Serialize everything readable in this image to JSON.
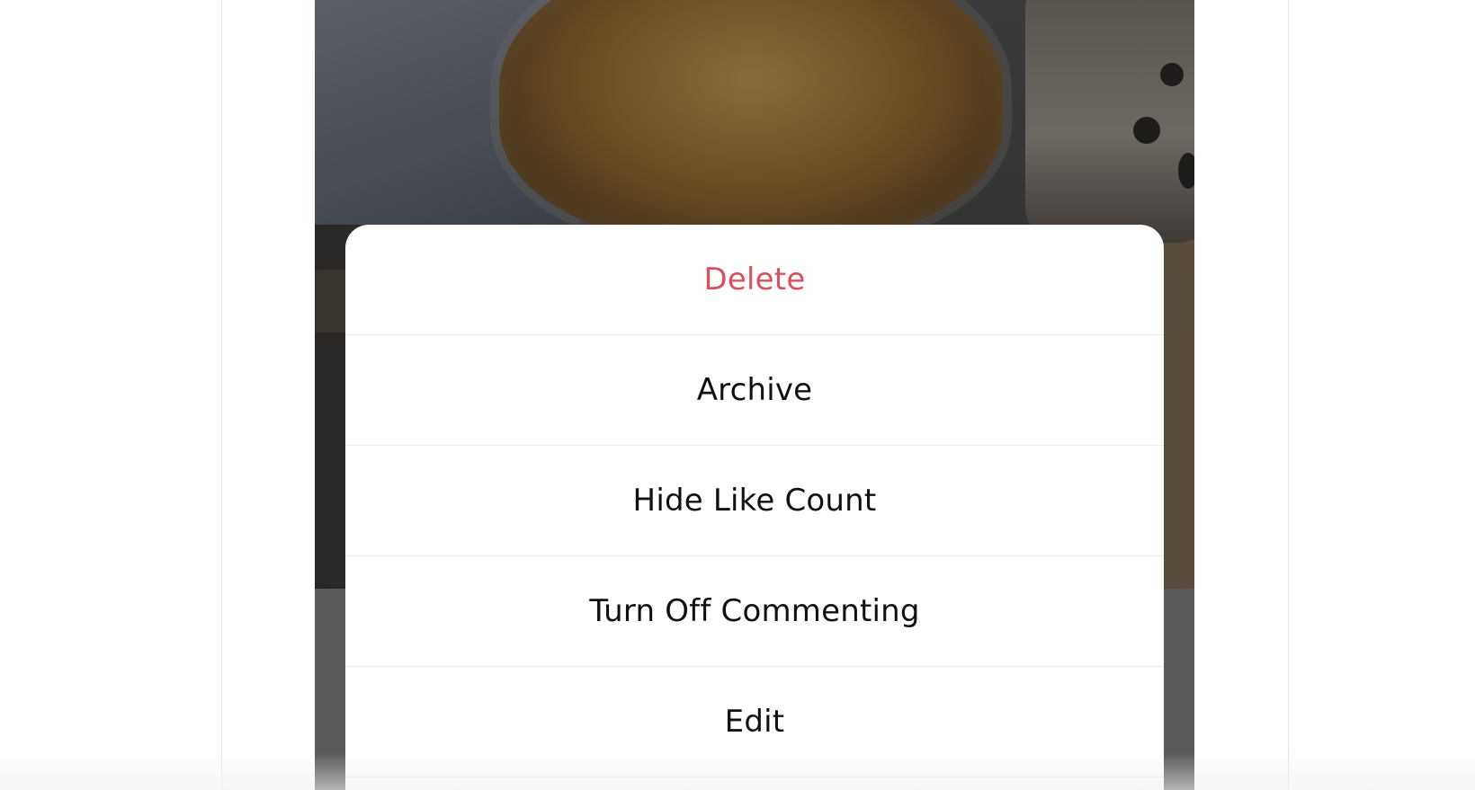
{
  "action_sheet": {
    "items": [
      {
        "label": "Delete",
        "style": "destructive"
      },
      {
        "label": "Archive",
        "style": "default"
      },
      {
        "label": "Hide Like Count",
        "style": "default"
      },
      {
        "label": "Turn Off Commenting",
        "style": "default"
      },
      {
        "label": "Edit",
        "style": "default"
      }
    ]
  },
  "colors": {
    "destructive": "#d9515e",
    "text": "#111111",
    "sheet_background": "#ffffff",
    "overlay": "#5a5a5a"
  }
}
